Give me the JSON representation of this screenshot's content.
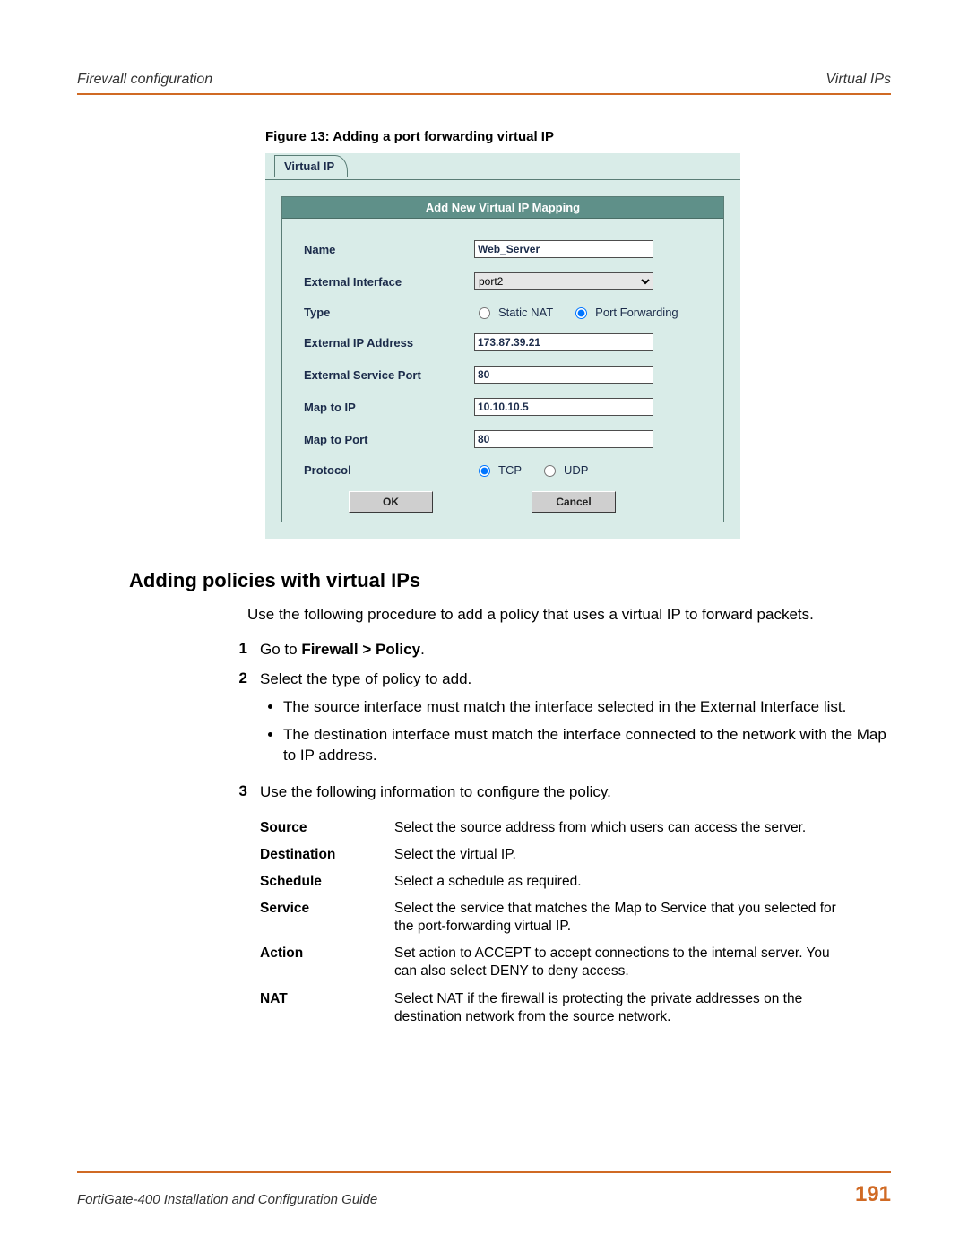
{
  "header": {
    "left": "Firewall configuration",
    "right": "Virtual IPs"
  },
  "figure_caption": "Figure 13: Adding a port forwarding virtual IP",
  "vip_panel": {
    "tab_label": "Virtual IP",
    "title": "Add New Virtual IP Mapping",
    "name_label": "Name",
    "name_value": "Web_Server",
    "ext_if_label": "External Interface",
    "ext_if_value": "port2",
    "type_label": "Type",
    "type_static": "Static NAT",
    "type_pf": "Port Forwarding",
    "ext_ip_label": "External IP Address",
    "ext_ip_value": "173.87.39.21",
    "ext_port_label": "External Service Port",
    "ext_port_value": "80",
    "map_ip_label": "Map to IP",
    "map_ip_value": "10.10.10.5",
    "map_port_label": "Map to Port",
    "map_port_value": "80",
    "protocol_label": "Protocol",
    "protocol_tcp": "TCP",
    "protocol_udp": "UDP",
    "ok": "OK",
    "cancel": "Cancel"
  },
  "section_heading": "Adding policies with virtual IPs",
  "intro": "Use the following procedure to add a policy that uses a virtual IP to forward packets.",
  "step1_prefix": "Go to ",
  "step1_bold": "Firewall > Policy",
  "step1_suffix": ".",
  "step2": "Select the type of policy to add.",
  "step2_b1": "The source interface must match the interface selected in the External Interface list.",
  "step2_b2": "The destination interface must match the interface connected to the network with the Map to IP address.",
  "step3": "Use the following information to configure the policy.",
  "policy_table": [
    {
      "label": "Source",
      "value": "Select the source address from which users can access the server."
    },
    {
      "label": "Destination",
      "value": "Select the virtual IP."
    },
    {
      "label": "Schedule",
      "value": "Select a schedule as required."
    },
    {
      "label": "Service",
      "value": "Select the service that matches the Map to Service that you selected for the port-forwarding virtual IP."
    },
    {
      "label": "Action",
      "value": "Set action to ACCEPT to accept connections to the internal server. You can also select DENY to deny access."
    },
    {
      "label": "NAT",
      "value": "Select NAT if the firewall is protecting the private addresses on the destination network from the source network."
    }
  ],
  "footer": {
    "left": "FortiGate-400 Installation and Configuration Guide",
    "page": "191"
  }
}
